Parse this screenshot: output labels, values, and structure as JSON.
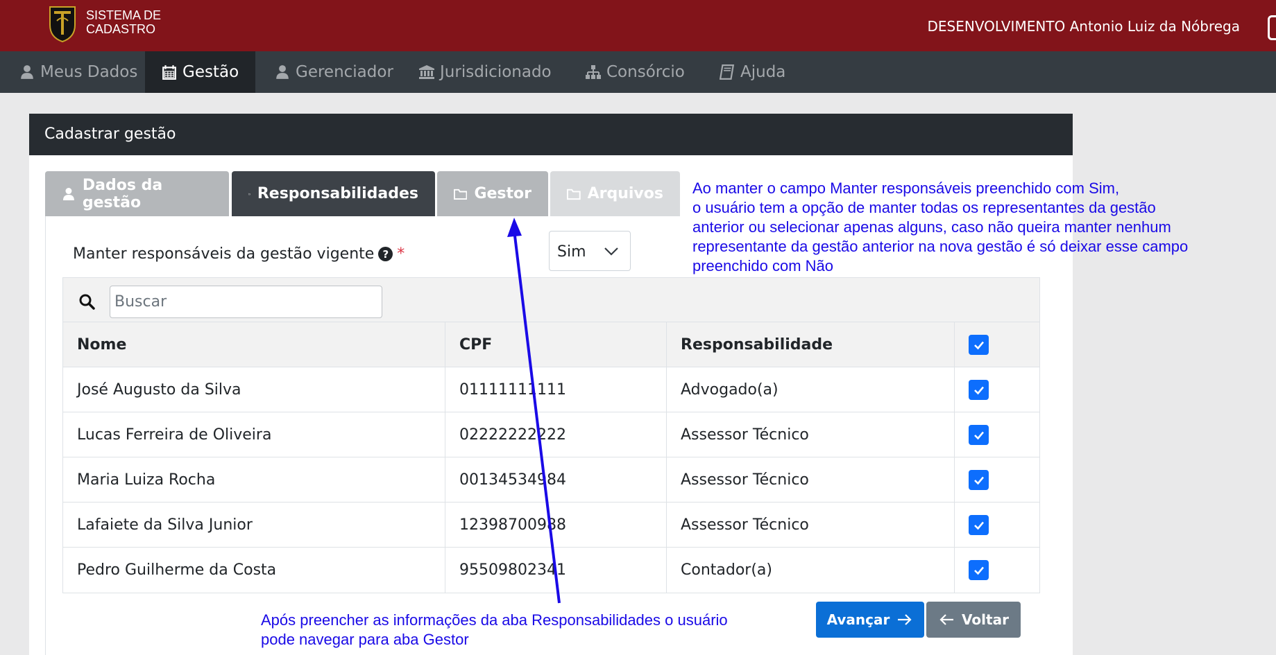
{
  "header": {
    "brand_line1": "SISTEMA DE",
    "brand_line2": "CADASTRO",
    "user_text": "DESENVOLVIMENTO Antonio Luiz da Nóbrega"
  },
  "nav": [
    {
      "label": "Meus Dados",
      "icon": "user-icon"
    },
    {
      "label": "Gestão",
      "icon": "calendar-icon"
    },
    {
      "label": "Gerenciador",
      "icon": "user-icon"
    },
    {
      "label": "Jurisdicionado",
      "icon": "bank-icon"
    },
    {
      "label": "Consórcio",
      "icon": "sitemap-icon"
    },
    {
      "label": "Ajuda",
      "icon": "book-icon"
    }
  ],
  "card": {
    "title": "Cadastrar gestão"
  },
  "tabs": [
    {
      "label": "Dados da gestão",
      "icon": "user-icon"
    },
    {
      "label": "Responsabilidades",
      "icon": "folder-icon"
    },
    {
      "label": "Gestor",
      "icon": "folder-icon"
    },
    {
      "label": "Arquivos",
      "icon": "folder-icon"
    }
  ],
  "form": {
    "label": "Manter responsáveis da gestão vigente",
    "required_mark": "*",
    "select_value": "Sim"
  },
  "search": {
    "placeholder": "Buscar"
  },
  "table": {
    "headers": [
      "Nome",
      "CPF",
      "Responsabilidade"
    ],
    "rows": [
      {
        "nome": "José Augusto da Silva",
        "cpf": "01111111111",
        "resp": "Advogado(a)"
      },
      {
        "nome": "Lucas Ferreira de Oliveira",
        "cpf": "02222222222",
        "resp": "Assessor Técnico"
      },
      {
        "nome": "Maria Luiza Rocha",
        "cpf": "00134534984",
        "resp": "Assessor Técnico"
      },
      {
        "nome": "Lafaiete da Silva Junior",
        "cpf": "12398700988",
        "resp": "Assessor Técnico"
      },
      {
        "nome": "Pedro Guilherme da Costa",
        "cpf": "95509802341",
        "resp": "Contador(a)"
      }
    ]
  },
  "buttons": {
    "next": "Avançar",
    "back": "Voltar"
  },
  "annotations": {
    "top_lines": [
      "Ao manter o campo Manter responsáveis preenchido com Sim,",
      "o usuário tem a opção de manter todas os representantes da gestão",
      "anterior ou selecionar apenas alguns, caso não queira manter nenhum",
      "representante da gestão anterior na nova gestão é só deixar esse campo",
      "preenchido com Não"
    ],
    "bottom_lines": [
      "Após preencher as informações da aba Responsabilidades o usuário",
      "pode navegar para aba Gestor"
    ]
  },
  "colors": {
    "header_bg": "#82141a",
    "navbar_bg": "#353c42",
    "primary": "#0d6efd",
    "annotation": "#1a0ae6"
  }
}
